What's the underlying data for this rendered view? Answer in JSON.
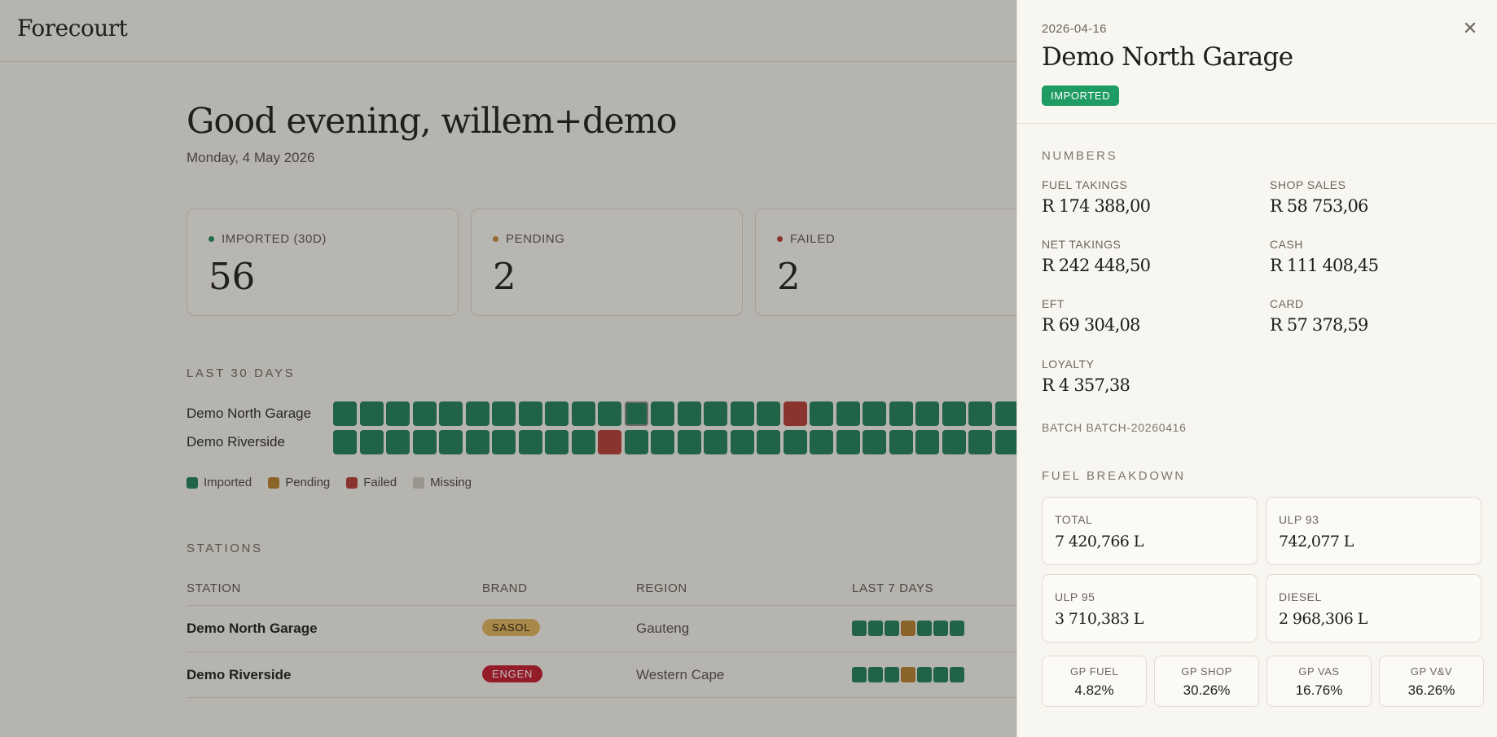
{
  "app": {
    "logo": "Forecourt"
  },
  "colors": {
    "imported": "#1e7f56",
    "pending": "#b7802d",
    "failed": "#b53b35",
    "missing": "#c9c6bd",
    "badge": "#1f9c62"
  },
  "greeting": {
    "title": "Good evening, willem+demo",
    "date": "Monday, 4 May 2026"
  },
  "stats": [
    {
      "label": "IMPORTED (30D)",
      "value": "56",
      "color": "#1e8a5c"
    },
    {
      "label": "PENDING",
      "value": "2",
      "color": "#c08a38"
    },
    {
      "label": "FAILED",
      "value": "2",
      "color": "#b53b35"
    }
  ],
  "heatmap": {
    "heading": "LAST 30 DAYS",
    "rows": [
      {
        "name": "Demo North Garage",
        "days": [
          "i",
          "i",
          "i",
          "i",
          "i",
          "i",
          "i",
          "i",
          "i",
          "i",
          "i",
          "s",
          "i",
          "i",
          "i",
          "i",
          "i",
          "f",
          "i",
          "i",
          "i",
          "i",
          "i",
          "i",
          "i",
          "i",
          "i",
          "i",
          "i",
          "i"
        ]
      },
      {
        "name": "Demo Riverside",
        "days": [
          "i",
          "i",
          "i",
          "i",
          "i",
          "i",
          "i",
          "i",
          "i",
          "i",
          "f",
          "i",
          "i",
          "i",
          "i",
          "i",
          "i",
          "i",
          "i",
          "i",
          "i",
          "i",
          "i",
          "i",
          "i",
          "i",
          "i",
          "i",
          "i",
          "i"
        ]
      }
    ],
    "legend": [
      {
        "label": "Imported",
        "color": "#1e7f56"
      },
      {
        "label": "Pending",
        "color": "#b7802d"
      },
      {
        "label": "Failed",
        "color": "#b53b35"
      },
      {
        "label": "Missing",
        "color": "#c9c6bd"
      }
    ]
  },
  "stations": {
    "heading": "STATIONS",
    "columns": [
      "STATION",
      "BRAND",
      "REGION",
      "LAST 7 DAYS"
    ],
    "rows": [
      {
        "name": "Demo North Garage",
        "brand": "SASOL",
        "brand_bg": "#e0b45a",
        "brand_fg": "#2a2415",
        "region": "Gauteng",
        "last7": [
          "i",
          "i",
          "i",
          "p",
          "i",
          "i",
          "i"
        ]
      },
      {
        "name": "Demo Riverside",
        "brand": "ENGEN",
        "brand_bg": "#c3172b",
        "brand_fg": "#ffffff",
        "region": "Western Cape",
        "last7": [
          "i",
          "i",
          "i",
          "p",
          "i",
          "i",
          "i"
        ]
      }
    ]
  },
  "drawer": {
    "date": "2026-04-16",
    "title": "Demo North Garage",
    "status": "IMPORTED",
    "close_icon": "close-icon",
    "numbers_heading": "NUMBERS",
    "numbers": [
      {
        "label": "FUEL TAKINGS",
        "value": "R 174 388,00"
      },
      {
        "label": "SHOP SALES",
        "value": "R 58 753,06"
      },
      {
        "label": "NET TAKINGS",
        "value": "R 242 448,50"
      },
      {
        "label": "CASH",
        "value": "R 111 408,45"
      },
      {
        "label": "EFT",
        "value": "R 69 304,08"
      },
      {
        "label": "CARD",
        "value": "R 57 378,59"
      },
      {
        "label": "LOYALTY",
        "value": "R 4 357,38"
      }
    ],
    "batch": "BATCH BATCH-20260416",
    "fuel_heading": "FUEL BREAKDOWN",
    "fuel": [
      {
        "label": "TOTAL",
        "value": "7 420,766 L"
      },
      {
        "label": "ULP 93",
        "value": "742,077 L"
      },
      {
        "label": "ULP 95",
        "value": "3 710,383 L"
      },
      {
        "label": "DIESEL",
        "value": "2 968,306 L"
      }
    ],
    "gp": [
      {
        "label": "GP FUEL",
        "value": "4.82%"
      },
      {
        "label": "GP SHOP",
        "value": "30.26%"
      },
      {
        "label": "GP VAS",
        "value": "16.76%"
      },
      {
        "label": "GP V&V",
        "value": "36.26%"
      }
    ]
  }
}
